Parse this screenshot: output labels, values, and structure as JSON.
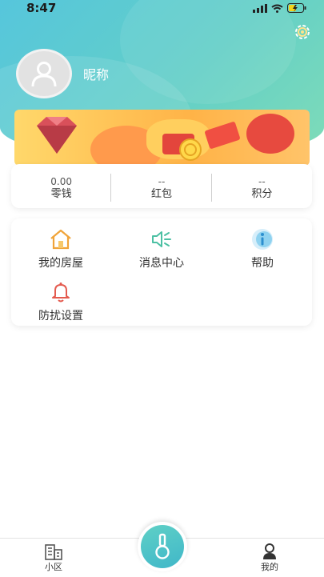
{
  "status_bar": {
    "time": "8:47"
  },
  "profile": {
    "nickname": "昵称"
  },
  "wallet": [
    {
      "value": "0.00",
      "label": "零钱"
    },
    {
      "value": "--",
      "label": "红包"
    },
    {
      "value": "--",
      "label": "积分"
    }
  ],
  "menu": [
    {
      "label": "我的房屋",
      "icon": "house-icon"
    },
    {
      "label": "消息中心",
      "icon": "speaker-icon"
    },
    {
      "label": "帮助",
      "icon": "info-icon"
    },
    {
      "label": "防扰设置",
      "icon": "bell-icon"
    }
  ],
  "tabbar": {
    "left_label": "小区",
    "right_label": "我的"
  },
  "colors": {
    "header_start": "#56c6dc",
    "header_end": "#7fdcb8",
    "accent": "#40b7c9"
  }
}
